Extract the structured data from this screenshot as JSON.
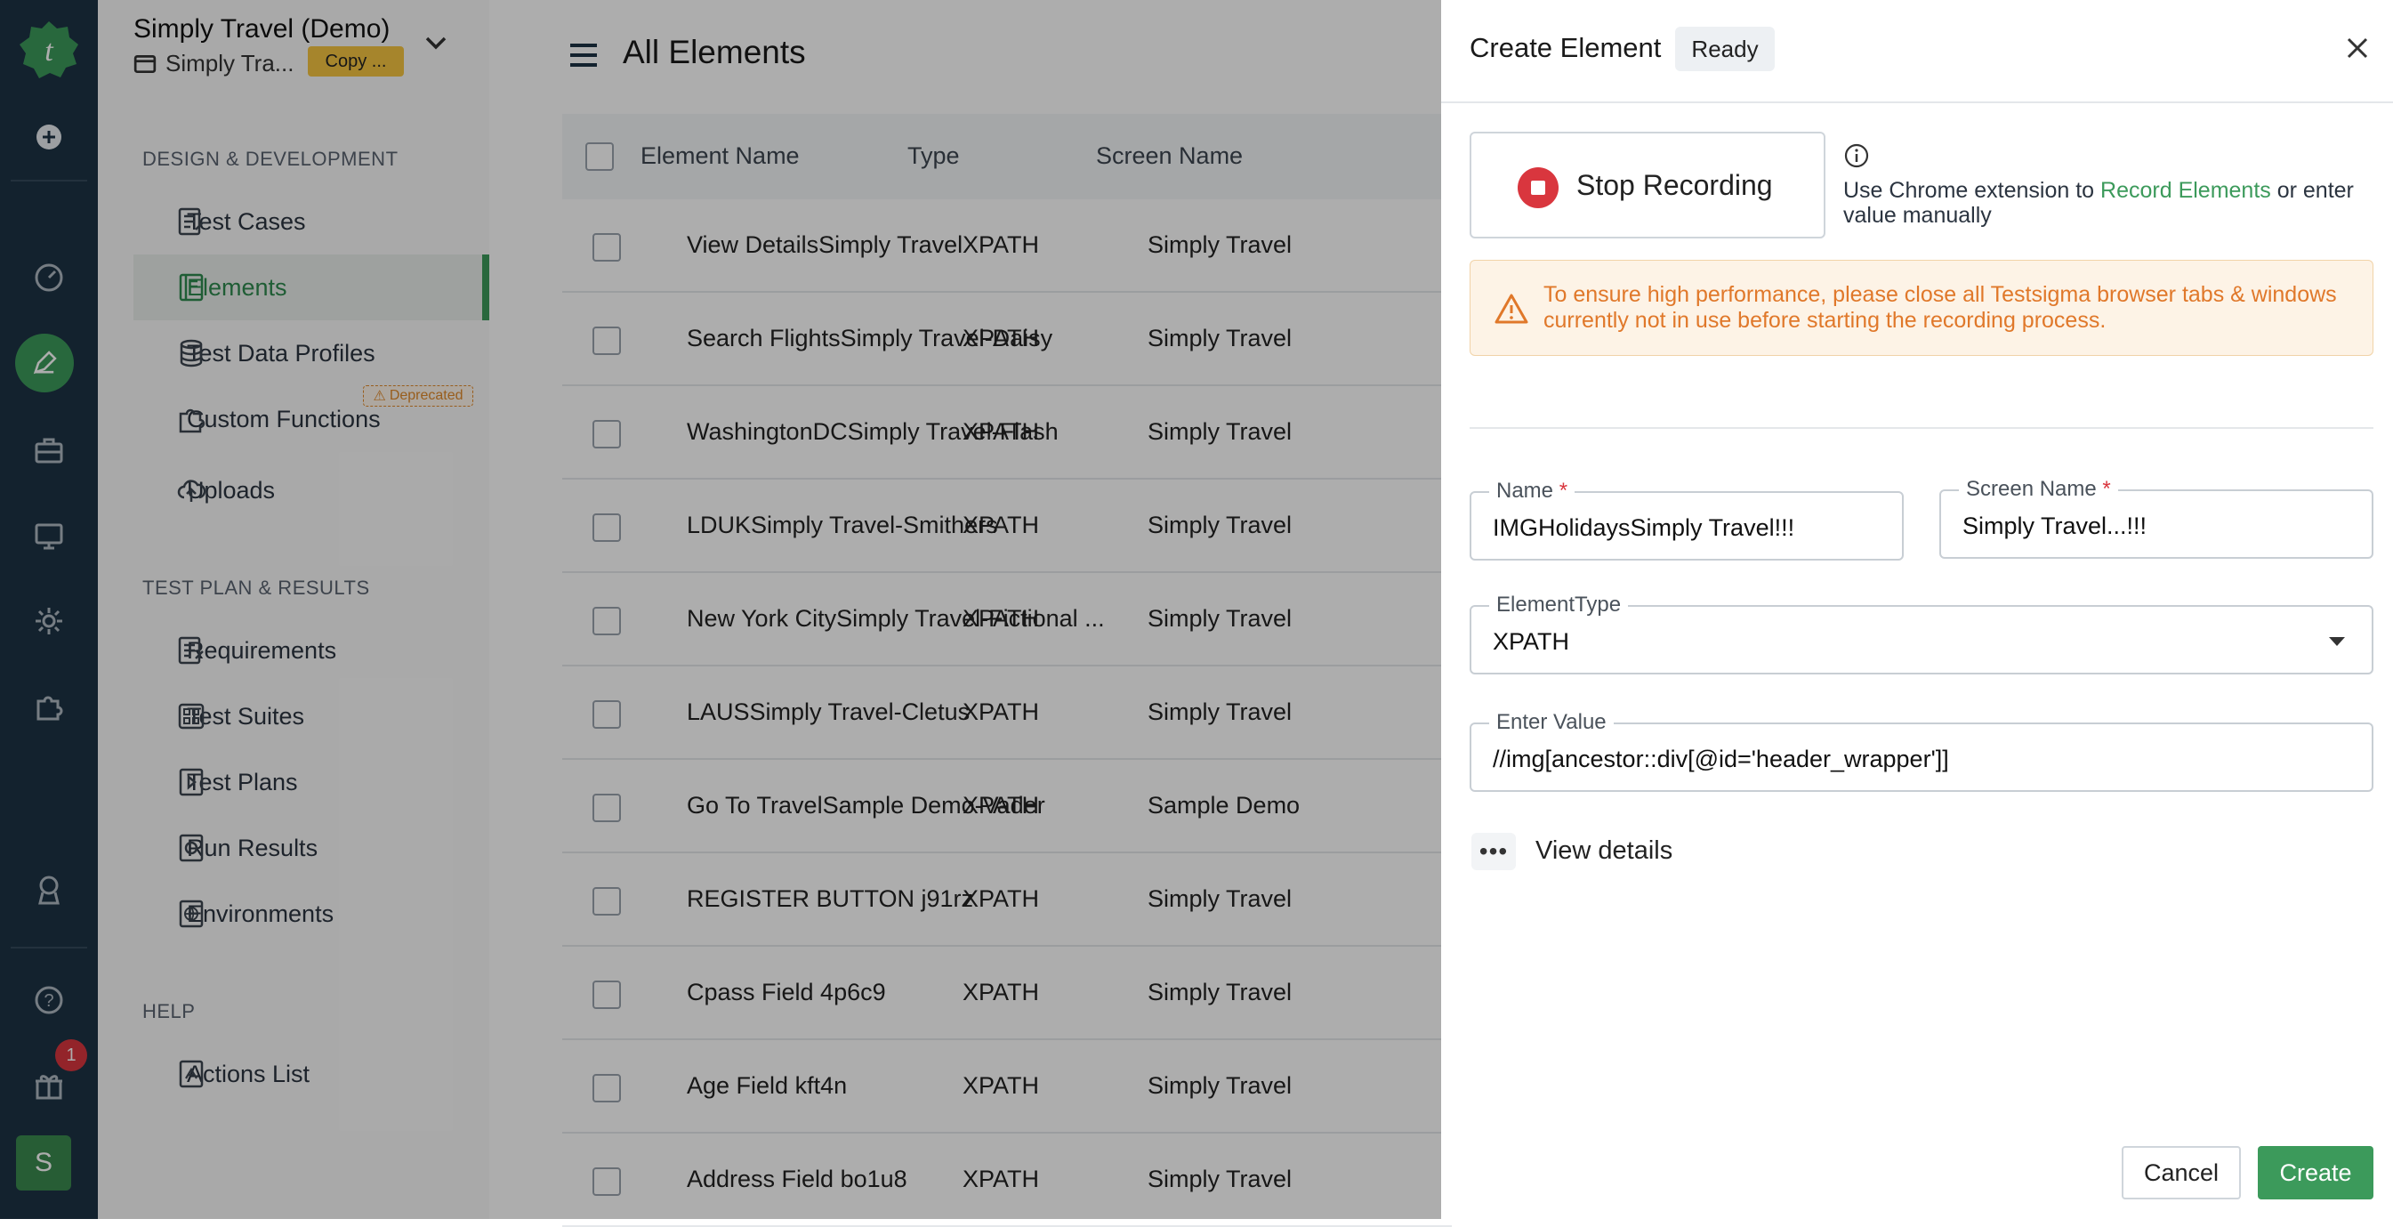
{
  "project": {
    "title": "Simply Travel (Demo)",
    "subtitle": "Simply Tra...",
    "copy_label": "Copy ..."
  },
  "sidebar": {
    "sections": [
      {
        "heading": "DESIGN & DEVELOPMENT"
      },
      {
        "heading": "TEST PLAN & RESULTS"
      },
      {
        "heading": "HELP"
      }
    ],
    "items": [
      {
        "label": "Test Cases",
        "icon": "test-cases-icon"
      },
      {
        "label": "Elements",
        "icon": "elements-icon",
        "active": true
      },
      {
        "label": "Test Data Profiles",
        "icon": "database-icon"
      },
      {
        "label": "Custom Functions",
        "icon": "puzzle-icon",
        "badge": "Deprecated"
      },
      {
        "label": "Uploads",
        "icon": "cloud-upload-icon"
      },
      {
        "label": "Requirements",
        "icon": "requirements-icon"
      },
      {
        "label": "Test Suites",
        "icon": "test-suites-icon"
      },
      {
        "label": "Test Plans",
        "icon": "test-plans-icon"
      },
      {
        "label": "Run Results",
        "icon": "run-results-icon"
      },
      {
        "label": "Environments",
        "icon": "globe-icon"
      },
      {
        "label": "Actions List",
        "icon": "actions-list-icon"
      }
    ]
  },
  "rail": {
    "notification_count": "1",
    "avatar_letter": "S",
    "accent": "#3c9a5b"
  },
  "main": {
    "title": "All Elements",
    "columns": [
      "Element Name",
      "Type",
      "Screen Name"
    ],
    "rows": [
      {
        "name": "View DetailsSimply Travel",
        "type": "XPATH",
        "screen": "Simply Travel"
      },
      {
        "name": "Search FlightsSimply Travel-Daisy",
        "type": "XPATH",
        "screen": "Simply Travel"
      },
      {
        "name": "WashingtonDCSimply Travel-Flash",
        "type": "XPATH",
        "screen": "Simply Travel"
      },
      {
        "name": "LDUKSimply Travel-Smithers",
        "type": "XPATH",
        "screen": "Simply Travel"
      },
      {
        "name": "New York CitySimply Travel-Fictional ...",
        "type": "XPATH",
        "screen": "Simply Travel"
      },
      {
        "name": "LAUSSimply Travel-Cletus",
        "type": "XPATH",
        "screen": "Simply Travel"
      },
      {
        "name": "Go To TravelSample Demo-Vader",
        "type": "XPATH",
        "screen": "Sample Demo"
      },
      {
        "name": "REGISTER BUTTON j91rz",
        "type": "XPATH",
        "screen": "Simply Travel"
      },
      {
        "name": "Cpass Field 4p6c9",
        "type": "XPATH",
        "screen": "Simply Travel"
      },
      {
        "name": "Age Field kft4n",
        "type": "XPATH",
        "screen": "Simply Travel"
      },
      {
        "name": "Address Field bo1u8",
        "type": "XPATH",
        "screen": "Simply Travel"
      }
    ]
  },
  "drawer": {
    "title": "Create Element",
    "status": "Ready",
    "stop_recording": "Stop Recording",
    "info_prefix": "Use Chrome extension to ",
    "info_link": "Record Elements",
    "info_suffix": " or enter value manually",
    "warning": "To ensure high performance, please close all Testsigma browser tabs & windows currently not in use before starting the recording process.",
    "name_label": "Name",
    "name_value": "IMGHolidaysSimply Travel!!!",
    "screen_label": "Screen Name",
    "screen_value": "Simply Travel...!!!",
    "type_label": "ElementType",
    "type_value": "XPATH",
    "value_label": "Enter Value",
    "value_value": "//img[ancestor::div[@id='header_wrapper']]",
    "required_mark": "*",
    "more_dots": "•••",
    "view_details": "View details",
    "cancel": "Cancel",
    "create": "Create"
  }
}
